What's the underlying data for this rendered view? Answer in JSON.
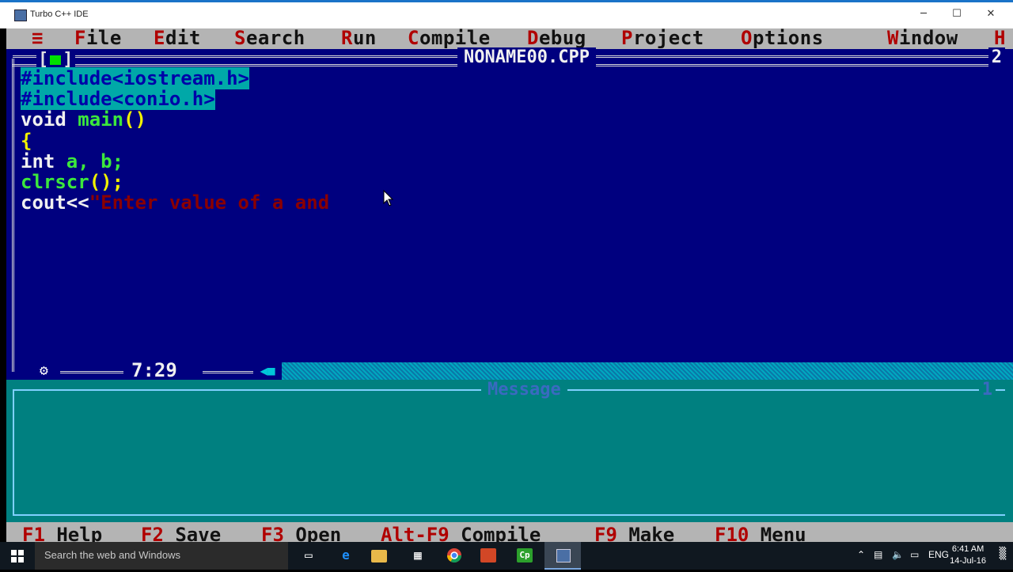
{
  "window": {
    "title": "Turbo C++ IDE",
    "minimize": "─",
    "maximize": "☐",
    "close": "✕"
  },
  "menu": {
    "sys": "≡",
    "items": [
      {
        "hk": "F",
        "rest": "ile"
      },
      {
        "hk": "E",
        "rest": "dit"
      },
      {
        "hk": "S",
        "rest": "earch"
      },
      {
        "hk": "R",
        "rest": "un"
      },
      {
        "hk": "C",
        "rest": "ompile"
      },
      {
        "hk": "D",
        "rest": "ebug"
      },
      {
        "hk": "P",
        "rest": "roject"
      },
      {
        "hk": "O",
        "rest": "ptions"
      },
      {
        "hk": "W",
        "rest": "indow"
      },
      {
        "hk": "H",
        "rest": ""
      }
    ]
  },
  "editor": {
    "close_box": "[■]",
    "filename": "NONAME00.CPP",
    "window_number": "2",
    "lines": [
      {
        "sel": "#include<iostream.h>"
      },
      {
        "sel": "#include<conio.h>"
      },
      {
        "kw": "void ",
        "fn": "main",
        "br": "()"
      },
      {
        "br": "{"
      },
      {
        "kw": "int ",
        "fn": "a, b;"
      },
      {
        "fn": "clrscr",
        "br": "();"
      },
      {
        "kw": "cout<<",
        "str": "\"Enter value of a and"
      }
    ],
    "cursor_position": "7:29"
  },
  "message": {
    "title": "Message",
    "window_number": "1"
  },
  "status_keys": [
    {
      "key": "F1",
      "label": " Help"
    },
    {
      "key": "F2",
      "label": " Save"
    },
    {
      "key": "F3",
      "label": " Open"
    },
    {
      "key": "Alt-F9",
      "label": " Compile"
    },
    {
      "key": "F9",
      "label": " Make"
    },
    {
      "key": "F10",
      "label": " Menu"
    }
  ],
  "taskbar": {
    "search_placeholder": "Search the web and Windows",
    "language": "ENG",
    "time": "6:41 AM",
    "date": "14-Jul-16"
  }
}
